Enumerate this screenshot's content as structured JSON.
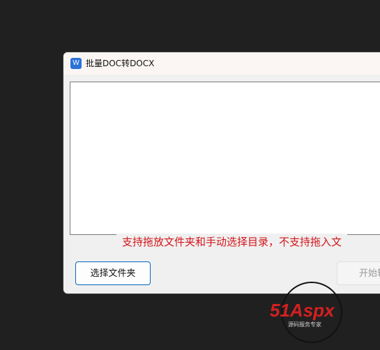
{
  "window": {
    "icon_letter": "W",
    "title": "批量DOC转DOCX"
  },
  "hint_text": "支持拖放文件夹和手动选择目录，不支持拖入文",
  "buttons": {
    "select_folder": "选择文件夹",
    "start": "开始转"
  },
  "watermark": {
    "brand_main": "51Aspx",
    "brand_sub": "源码服务专家"
  },
  "colors": {
    "desktop": "#202020",
    "hint_red": "#d4141a",
    "accent_blue": "#0067c0",
    "watermark_red": "#d42020",
    "watermark_green": "#2e8b22"
  }
}
